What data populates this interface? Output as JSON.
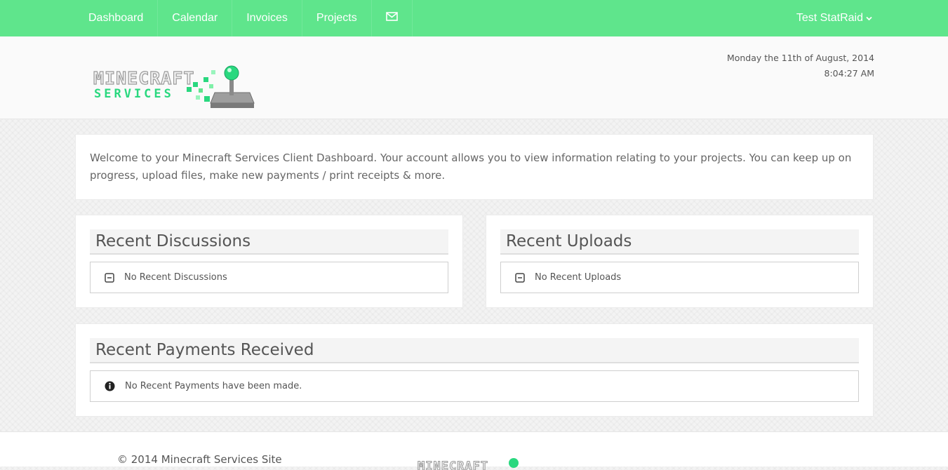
{
  "nav": {
    "items": [
      {
        "label": "Dashboard"
      },
      {
        "label": "Calendar"
      },
      {
        "label": "Invoices"
      },
      {
        "label": "Projects"
      }
    ],
    "mail_icon": "envelope-icon",
    "user_label": "Test StatRaid"
  },
  "header": {
    "logo_line1": "MINECRAFT",
    "logo_line2": "SERVICES",
    "date": "Monday the 11th of August, 2014",
    "time": "8:04:27 AM"
  },
  "welcome": {
    "text": "Welcome to your Minecraft Services Client Dashboard. Your account allows you to view information relating to your projects. You can keep up on progress, upload files, make new payments / print receipts & more."
  },
  "discussions": {
    "title": "Recent Discussions",
    "empty_text": "No Recent Discussions",
    "icon": "minus-square-icon"
  },
  "uploads": {
    "title": "Recent Uploads",
    "empty_text": "No Recent Uploads",
    "icon": "minus-square-icon"
  },
  "payments": {
    "title": "Recent Payments Received",
    "empty_text": "No Recent Payments have been made.",
    "icon": "info-circle-icon"
  },
  "footer": {
    "copyright": "© 2014 Minecraft Services Site"
  },
  "colors": {
    "nav_bg": "#5fe58c",
    "accent": "#2ad87f"
  }
}
